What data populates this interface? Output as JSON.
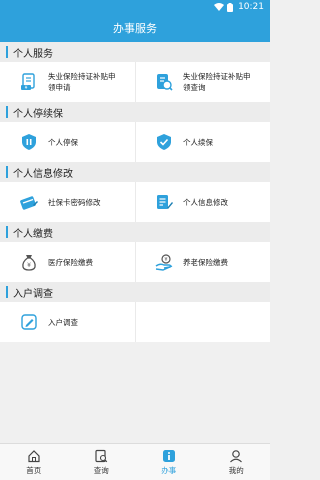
{
  "status": {
    "time": "10:21",
    "wifi_icon": "wifi-icon",
    "battery_icon": "battery-icon"
  },
  "appbar": {
    "title": "办事服务"
  },
  "accent": "#2ea1dc",
  "sections": [
    {
      "title": "个人服务",
      "items": [
        {
          "label": "失业保险持证补贴申领申请",
          "icon": "document-money-icon"
        },
        {
          "label": "失业保险持证补贴申领查询",
          "icon": "document-search-icon"
        }
      ]
    },
    {
      "title": "个人停续保",
      "items": [
        {
          "label": "个人停保",
          "icon": "shield-pause-icon"
        },
        {
          "label": "个人续保",
          "icon": "shield-renew-icon"
        }
      ]
    },
    {
      "title": "个人信息修改",
      "items": [
        {
          "label": "社保卡密码修改",
          "icon": "card-edit-icon"
        },
        {
          "label": "个人信息修改",
          "icon": "profile-edit-icon"
        }
      ]
    },
    {
      "title": "个人缴费",
      "items": [
        {
          "label": "医疗保险缴费",
          "icon": "money-bag-icon"
        },
        {
          "label": "养老保险缴费",
          "icon": "pension-payment-icon"
        }
      ]
    },
    {
      "title": "入户调查",
      "items": [
        {
          "label": "入户调查",
          "icon": "survey-pencil-icon"
        }
      ]
    }
  ],
  "tabs": [
    {
      "label": "首页",
      "icon": "home-icon",
      "active": false
    },
    {
      "label": "查询",
      "icon": "search-doc-icon",
      "active": false
    },
    {
      "label": "办事",
      "icon": "info-icon",
      "active": true
    },
    {
      "label": "我的",
      "icon": "user-icon",
      "active": false
    }
  ]
}
